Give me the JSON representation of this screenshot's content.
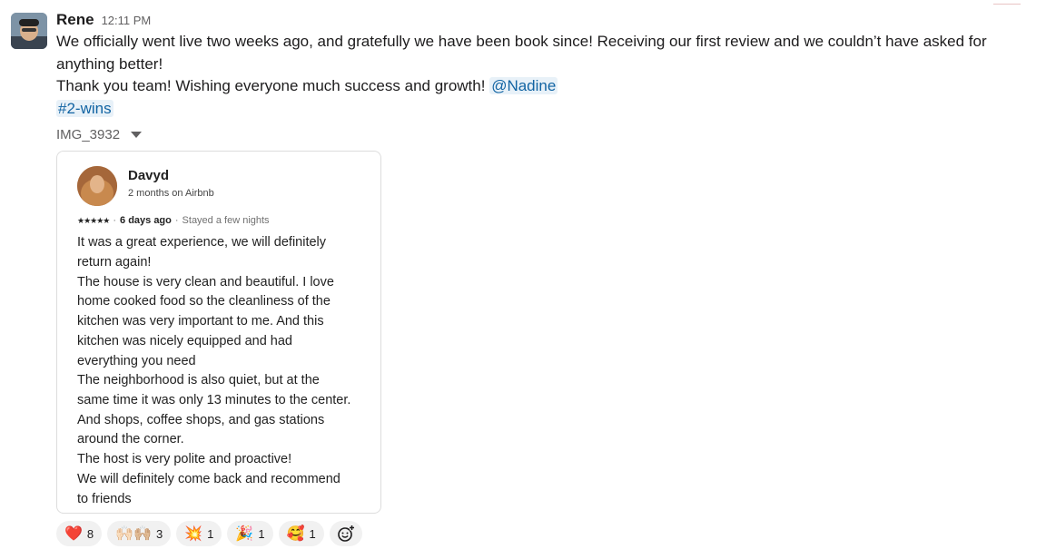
{
  "message": {
    "sender": "Rene",
    "time": "12:11 PM",
    "line1": "We officially went live two weeks ago, and gratefully we have been book since! Receiving our first review and we couldn’t have asked for anything better!",
    "line2": "Thank you team! Wishing everyone much success and growth!",
    "mention": "@Nadine",
    "channel": "#2-wins",
    "file_name": "IMG_3932"
  },
  "review": {
    "name": "Davyd",
    "meta": "2 months on Airbnb",
    "stars": "★★★★★",
    "sep": "·",
    "when": "6 days ago",
    "stay": "Stayed a few nights",
    "text": "It was a great experience, we will definitely\nreturn again!\nThe house is very clean and beautiful. I love\nhome cooked food so the cleanliness of the\nkitchen was very important to me. And this\nkitchen was nicely equipped and had\neverything you need\nThe neighborhood is also quiet, but at the\nsame time it was only 13 minutes to the center.\nAnd shops, coffee shops, and gas stations\naround the corner.\nThe host is very polite and proactive!\nWe will definitely come back and recommend\nto friends"
  },
  "reactions": [
    {
      "emoji": "❤️",
      "icon": "red-heart-icon",
      "count": "8"
    },
    {
      "emoji": "🙌🏻🙌🏼",
      "icon": "raised-hands-icon",
      "count": "3"
    },
    {
      "emoji": "💥",
      "icon": "collision-icon",
      "count": "1"
    },
    {
      "emoji": "🎉",
      "icon": "party-popper-icon",
      "count": "1"
    },
    {
      "emoji": "🥰",
      "icon": "smiling-face-hearts-icon",
      "count": "1"
    }
  ],
  "colors": {
    "link": "#1264a3",
    "mention_bg": "#e8f1f8",
    "pill_bg": "#f1f1f1"
  }
}
